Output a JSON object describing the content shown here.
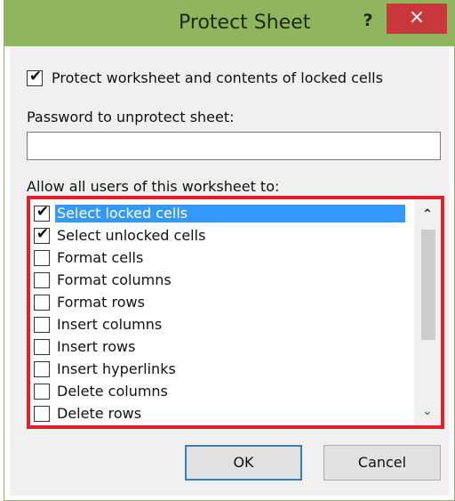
{
  "dialog": {
    "title": "Protect Sheet",
    "help_label": "?",
    "close_label": "×",
    "accent_color": "#8fb55e"
  },
  "protect": {
    "checked": true,
    "label": "Protect worksheet and contents of locked cells"
  },
  "password": {
    "label": "Password to unprotect sheet:",
    "value": ""
  },
  "permissions": {
    "label": "Allow all users of this worksheet to:",
    "items": [
      {
        "label": "Select locked cells",
        "checked": true,
        "selected": true
      },
      {
        "label": "Select unlocked cells",
        "checked": true,
        "selected": false
      },
      {
        "label": "Format cells",
        "checked": false,
        "selected": false
      },
      {
        "label": "Format columns",
        "checked": false,
        "selected": false
      },
      {
        "label": "Format rows",
        "checked": false,
        "selected": false
      },
      {
        "label": "Insert columns",
        "checked": false,
        "selected": false
      },
      {
        "label": "Insert rows",
        "checked": false,
        "selected": false
      },
      {
        "label": "Insert hyperlinks",
        "checked": false,
        "selected": false
      },
      {
        "label": "Delete columns",
        "checked": false,
        "selected": false
      },
      {
        "label": "Delete rows",
        "checked": false,
        "selected": false
      }
    ],
    "highlight_color": "#e0202a"
  },
  "buttons": {
    "ok": "OK",
    "cancel": "Cancel"
  }
}
